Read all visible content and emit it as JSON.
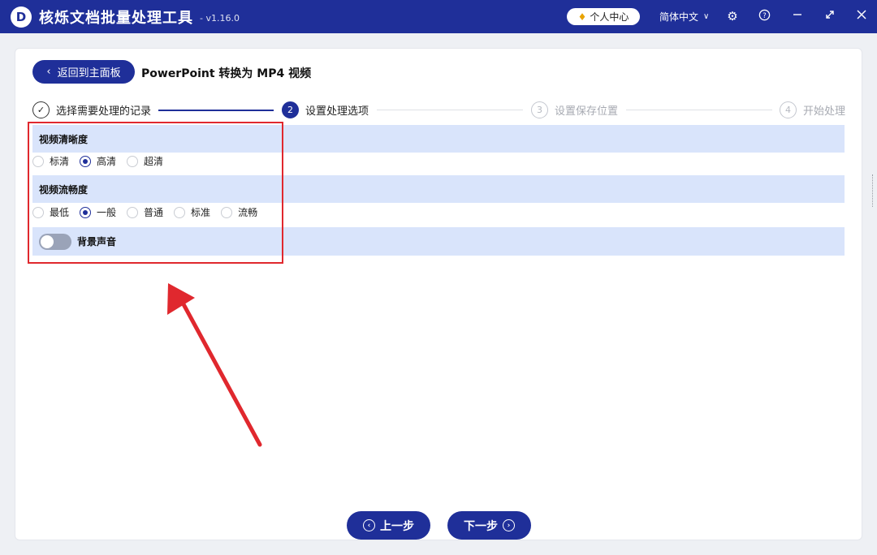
{
  "titlebar": {
    "logo_letter": "D",
    "title": "核烁文档批量处理工具",
    "version": "- v1.16.0",
    "user_center": "个人中心",
    "language": "简体中文"
  },
  "header": {
    "back_label": "返回到主面板",
    "page_title": "PowerPoint 转换为 MP4 视频"
  },
  "steps": [
    {
      "number": "✓",
      "label": "选择需要处理的记录",
      "state": "done"
    },
    {
      "number": "2",
      "label": "设置处理选项",
      "state": "active"
    },
    {
      "number": "3",
      "label": "设置保存位置",
      "state": "pending"
    },
    {
      "number": "4",
      "label": "开始处理",
      "state": "pending"
    }
  ],
  "options": {
    "clarity": {
      "label": "视频清晰度",
      "choices": [
        "标清",
        "高清",
        "超清"
      ],
      "selected": "高清"
    },
    "fluency": {
      "label": "视频流畅度",
      "choices": [
        "最低",
        "一般",
        "普通",
        "标准",
        "流畅"
      ],
      "selected": "一般"
    },
    "background_audio": {
      "label": "背景声音",
      "enabled": false
    }
  },
  "footer": {
    "prev_label": "上一步",
    "next_label": "下一步"
  },
  "colors": {
    "brand": "#1f2f99",
    "bar": "#d9e4fb",
    "annotation": "#e0282e"
  }
}
